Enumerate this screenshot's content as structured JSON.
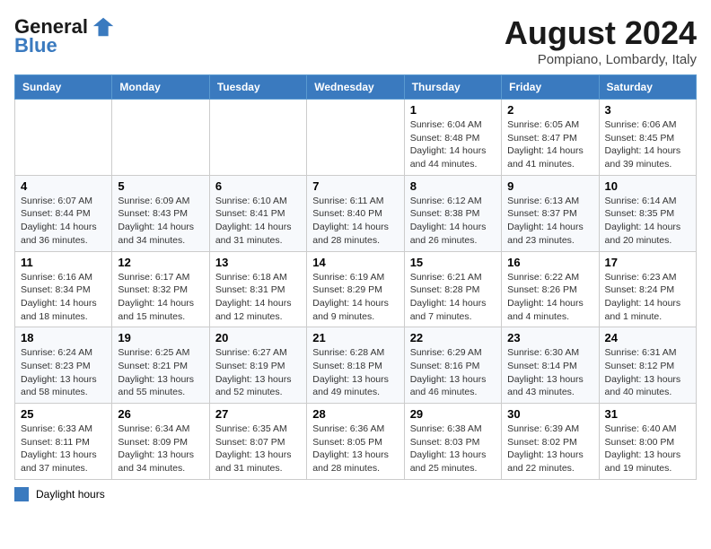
{
  "header": {
    "logo_general": "General",
    "logo_blue": "Blue",
    "month_year": "August 2024",
    "location": "Pompiano, Lombardy, Italy"
  },
  "weekdays": [
    "Sunday",
    "Monday",
    "Tuesday",
    "Wednesday",
    "Thursday",
    "Friday",
    "Saturday"
  ],
  "weeks": [
    [
      {
        "day": "",
        "info": ""
      },
      {
        "day": "",
        "info": ""
      },
      {
        "day": "",
        "info": ""
      },
      {
        "day": "",
        "info": ""
      },
      {
        "day": "1",
        "info": "Sunrise: 6:04 AM\nSunset: 8:48 PM\nDaylight: 14 hours and 44 minutes."
      },
      {
        "day": "2",
        "info": "Sunrise: 6:05 AM\nSunset: 8:47 PM\nDaylight: 14 hours and 41 minutes."
      },
      {
        "day": "3",
        "info": "Sunrise: 6:06 AM\nSunset: 8:45 PM\nDaylight: 14 hours and 39 minutes."
      }
    ],
    [
      {
        "day": "4",
        "info": "Sunrise: 6:07 AM\nSunset: 8:44 PM\nDaylight: 14 hours and 36 minutes."
      },
      {
        "day": "5",
        "info": "Sunrise: 6:09 AM\nSunset: 8:43 PM\nDaylight: 14 hours and 34 minutes."
      },
      {
        "day": "6",
        "info": "Sunrise: 6:10 AM\nSunset: 8:41 PM\nDaylight: 14 hours and 31 minutes."
      },
      {
        "day": "7",
        "info": "Sunrise: 6:11 AM\nSunset: 8:40 PM\nDaylight: 14 hours and 28 minutes."
      },
      {
        "day": "8",
        "info": "Sunrise: 6:12 AM\nSunset: 8:38 PM\nDaylight: 14 hours and 26 minutes."
      },
      {
        "day": "9",
        "info": "Sunrise: 6:13 AM\nSunset: 8:37 PM\nDaylight: 14 hours and 23 minutes."
      },
      {
        "day": "10",
        "info": "Sunrise: 6:14 AM\nSunset: 8:35 PM\nDaylight: 14 hours and 20 minutes."
      }
    ],
    [
      {
        "day": "11",
        "info": "Sunrise: 6:16 AM\nSunset: 8:34 PM\nDaylight: 14 hours and 18 minutes."
      },
      {
        "day": "12",
        "info": "Sunrise: 6:17 AM\nSunset: 8:32 PM\nDaylight: 14 hours and 15 minutes."
      },
      {
        "day": "13",
        "info": "Sunrise: 6:18 AM\nSunset: 8:31 PM\nDaylight: 14 hours and 12 minutes."
      },
      {
        "day": "14",
        "info": "Sunrise: 6:19 AM\nSunset: 8:29 PM\nDaylight: 14 hours and 9 minutes."
      },
      {
        "day": "15",
        "info": "Sunrise: 6:21 AM\nSunset: 8:28 PM\nDaylight: 14 hours and 7 minutes."
      },
      {
        "day": "16",
        "info": "Sunrise: 6:22 AM\nSunset: 8:26 PM\nDaylight: 14 hours and 4 minutes."
      },
      {
        "day": "17",
        "info": "Sunrise: 6:23 AM\nSunset: 8:24 PM\nDaylight: 14 hours and 1 minute."
      }
    ],
    [
      {
        "day": "18",
        "info": "Sunrise: 6:24 AM\nSunset: 8:23 PM\nDaylight: 13 hours and 58 minutes."
      },
      {
        "day": "19",
        "info": "Sunrise: 6:25 AM\nSunset: 8:21 PM\nDaylight: 13 hours and 55 minutes."
      },
      {
        "day": "20",
        "info": "Sunrise: 6:27 AM\nSunset: 8:19 PM\nDaylight: 13 hours and 52 minutes."
      },
      {
        "day": "21",
        "info": "Sunrise: 6:28 AM\nSunset: 8:18 PM\nDaylight: 13 hours and 49 minutes."
      },
      {
        "day": "22",
        "info": "Sunrise: 6:29 AM\nSunset: 8:16 PM\nDaylight: 13 hours and 46 minutes."
      },
      {
        "day": "23",
        "info": "Sunrise: 6:30 AM\nSunset: 8:14 PM\nDaylight: 13 hours and 43 minutes."
      },
      {
        "day": "24",
        "info": "Sunrise: 6:31 AM\nSunset: 8:12 PM\nDaylight: 13 hours and 40 minutes."
      }
    ],
    [
      {
        "day": "25",
        "info": "Sunrise: 6:33 AM\nSunset: 8:11 PM\nDaylight: 13 hours and 37 minutes."
      },
      {
        "day": "26",
        "info": "Sunrise: 6:34 AM\nSunset: 8:09 PM\nDaylight: 13 hours and 34 minutes."
      },
      {
        "day": "27",
        "info": "Sunrise: 6:35 AM\nSunset: 8:07 PM\nDaylight: 13 hours and 31 minutes."
      },
      {
        "day": "28",
        "info": "Sunrise: 6:36 AM\nSunset: 8:05 PM\nDaylight: 13 hours and 28 minutes."
      },
      {
        "day": "29",
        "info": "Sunrise: 6:38 AM\nSunset: 8:03 PM\nDaylight: 13 hours and 25 minutes."
      },
      {
        "day": "30",
        "info": "Sunrise: 6:39 AM\nSunset: 8:02 PM\nDaylight: 13 hours and 22 minutes."
      },
      {
        "day": "31",
        "info": "Sunrise: 6:40 AM\nSunset: 8:00 PM\nDaylight: 13 hours and 19 minutes."
      }
    ]
  ],
  "legend": {
    "label": "Daylight hours"
  }
}
